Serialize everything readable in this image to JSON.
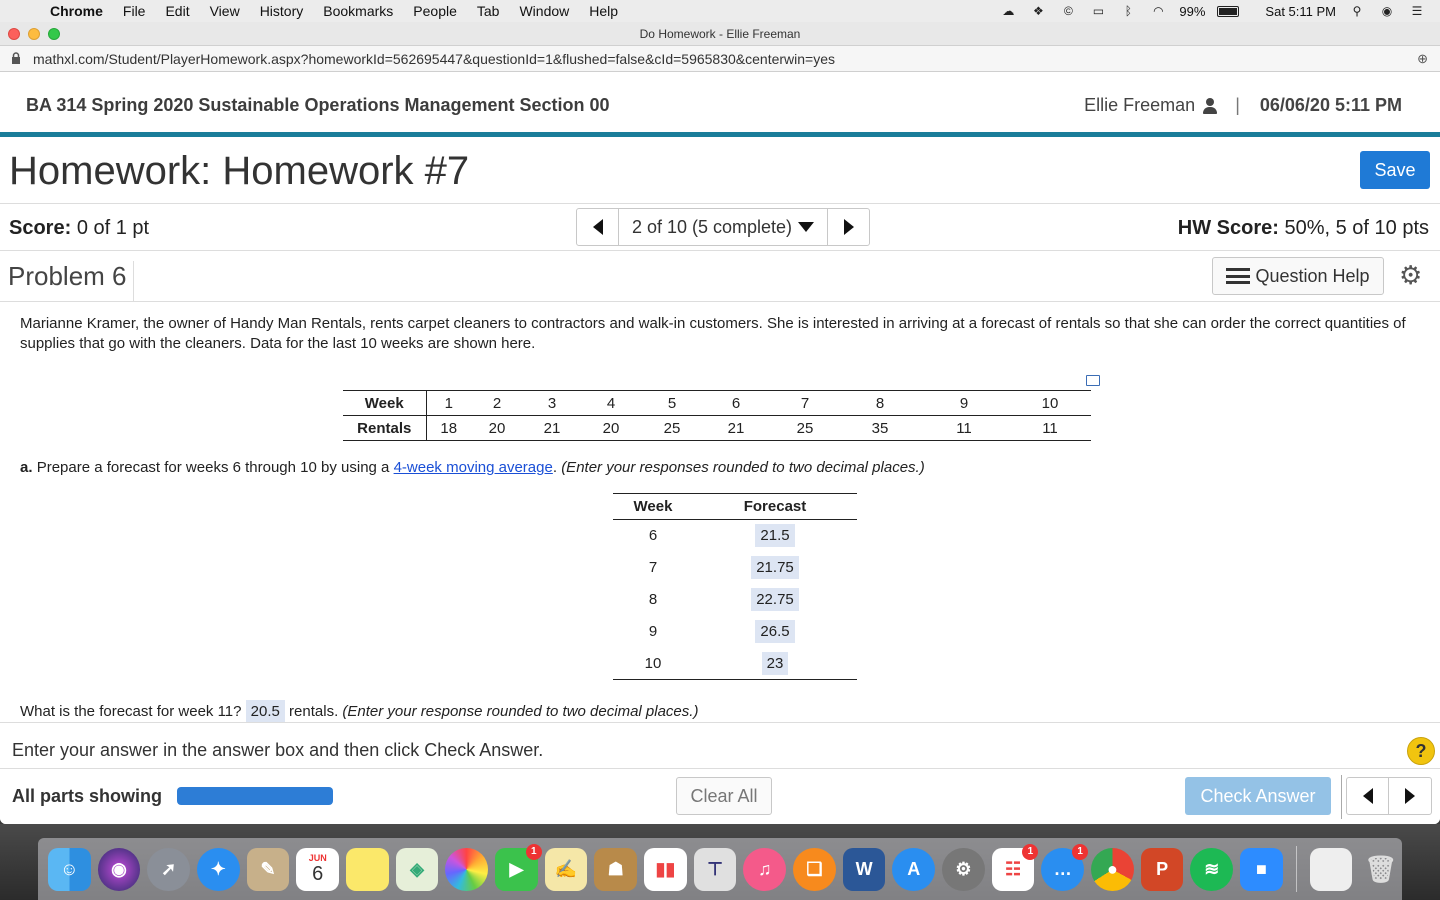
{
  "menubar": {
    "app": "Chrome",
    "items": [
      "File",
      "Edit",
      "View",
      "History",
      "Bookmarks",
      "People",
      "Tab",
      "Window",
      "Help"
    ],
    "battery": "99%",
    "clock": "Sat 5:11 PM"
  },
  "browser": {
    "window_title": "Do Homework - Ellie Freeman",
    "url": "mathxl.com/Student/PlayerHomework.aspx?homeworkId=562695447&questionId=1&flushed=false&cId=5965830&centerwin=yes"
  },
  "header": {
    "course": "BA 314 Spring 2020 Sustainable Operations Management Section 00",
    "user": "Ellie Freeman",
    "datetime": "06/06/20 5:11 PM"
  },
  "homework": {
    "title": "Homework: Homework #7",
    "save_label": "Save",
    "score_label": "Score:",
    "score_value": "0 of 1 pt",
    "nav_label": "2 of 10 (5 complete)",
    "hw_score_label": "HW Score:",
    "hw_score_value": "50%, 5 of 10 pts"
  },
  "problem": {
    "title": "Problem 6",
    "help_label": "Question Help",
    "prompt": "Marianne Kramer, the owner of Handy Man Rentals, rents carpet cleaners to contractors and walk-in customers. She is interested in arriving at a forecast of rentals so that she can order the correct quantities of supplies that go with the cleaners. Data for the last 10 weeks are shown here.",
    "data_table": {
      "row1_label": "Week",
      "row2_label": "Rentals",
      "weeks": [
        "1",
        "2",
        "3",
        "4",
        "5",
        "6",
        "7",
        "8",
        "9",
        "10"
      ],
      "rentals": [
        "18",
        "20",
        "21",
        "20",
        "25",
        "21",
        "25",
        "35",
        "11",
        "11"
      ]
    },
    "part_a": {
      "label": "a.",
      "text_before": "Prepare a forecast for weeks 6 through 10 by using a",
      "link": "4-week moving average",
      "text_after": ".",
      "instruction": "(Enter your responses rounded to two decimal places.)"
    },
    "forecast_table": {
      "col1": "Week",
      "col2": "Forecast",
      "rows": [
        {
          "week": "6",
          "forecast": "21.5"
        },
        {
          "week": "7",
          "forecast": "21.75"
        },
        {
          "week": "8",
          "forecast": "22.75"
        },
        {
          "week": "9",
          "forecast": "26.5"
        },
        {
          "week": "10",
          "forecast": "23"
        }
      ]
    },
    "week11": {
      "question": "What is the forecast for week 11?",
      "answer": "20.5",
      "unit": "rentals.",
      "instruction": "(Enter your response rounded to two decimal places.)"
    }
  },
  "footer": {
    "message": "Enter your answer in the answer box and then click Check Answer.",
    "help_glyph": "?",
    "all_parts": "All parts showing",
    "progress_fraction": 1.0,
    "clear_label": "Clear All",
    "check_label": "Check Answer"
  },
  "dock": {
    "calendar_month": "JUN",
    "calendar_day": "6",
    "badge": "1"
  },
  "colors": {
    "accent_blue": "#1f7ad6",
    "teal_rule": "#1a7d9a",
    "answer_bg": "#dde5f3",
    "check_disabled": "#94c2e6"
  }
}
